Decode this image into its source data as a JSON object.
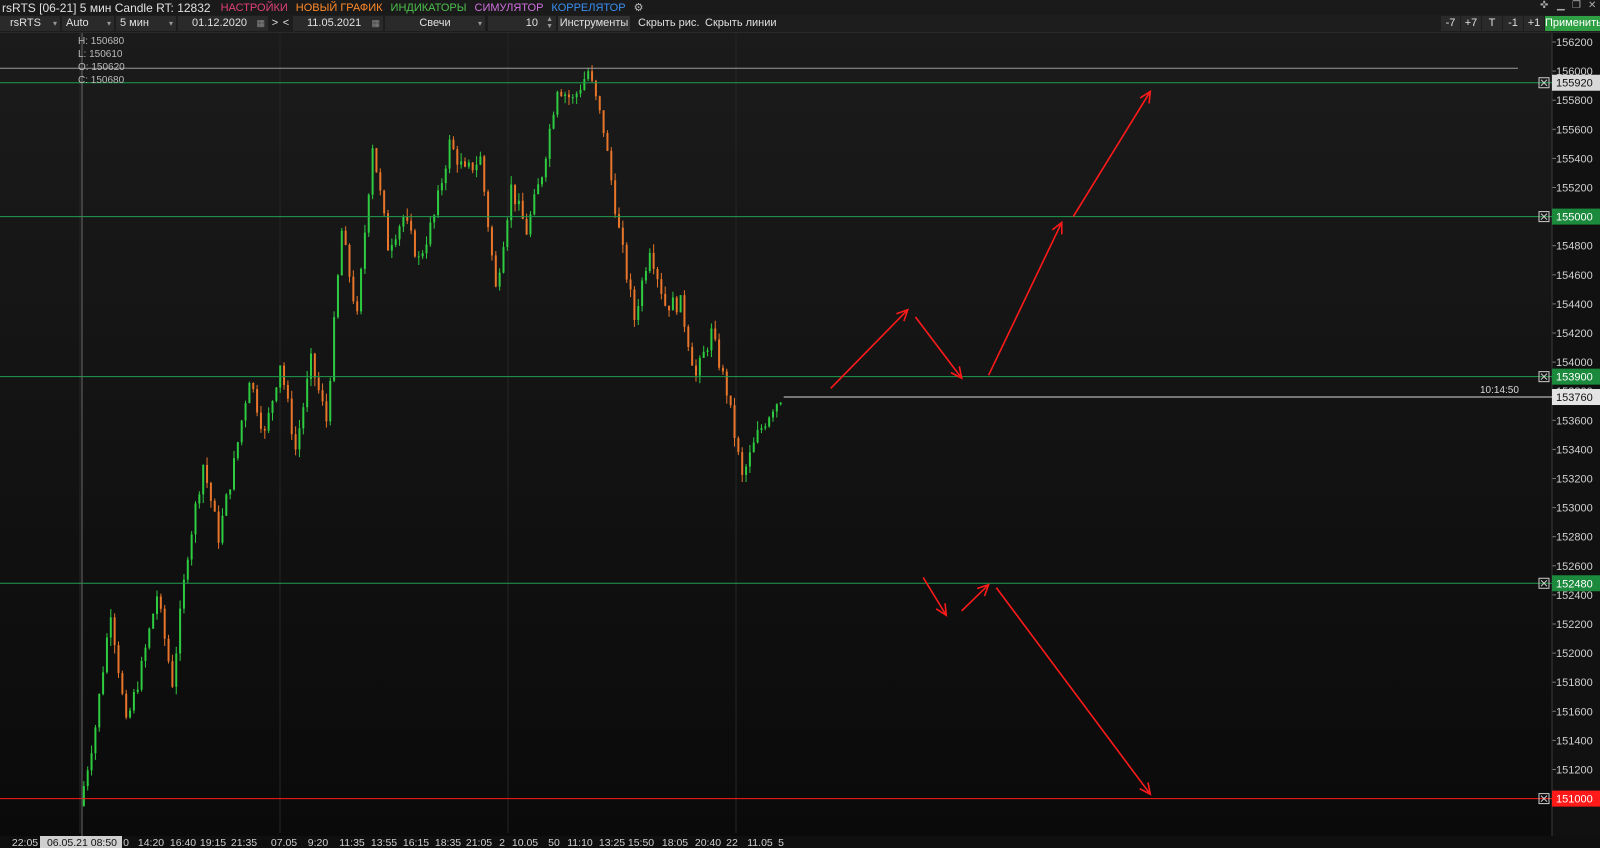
{
  "window": {
    "title": "rsRTS [06-21] 5 мин Candle RT: 12832",
    "menu": [
      {
        "label": "НАСТРОЙКИ",
        "color": "#e0407a"
      },
      {
        "label": "НОВЫЙ ГРАФИК",
        "color": "#ff8a2a"
      },
      {
        "label": "ИНДИКАТОРЫ",
        "color": "#4ec04e"
      },
      {
        "label": "СИМУЛЯТОР",
        "color": "#d070e0"
      },
      {
        "label": "КОРРЕЛЯТОР",
        "color": "#3a8ff0"
      }
    ],
    "settings_icon": "gears-icon",
    "controls": [
      "pin-icon",
      "minimize-icon",
      "restore-icon",
      "close-icon"
    ]
  },
  "toolbar": {
    "symbol": "rsRTS",
    "scale": "Auto",
    "timeframe": "5 мин",
    "date_from": "01.12.2020",
    "nav_next": ">",
    "nav_prev": "<",
    "date_to": "11.05.2021",
    "chart_type": "Свечи",
    "count": "10",
    "instruments": "Инструменты",
    "hide_drawings": "Скрыть рис.",
    "hide_lines": "Скрыть линии",
    "zoom_buttons": [
      "-7",
      "+7",
      "T",
      "-1",
      "+1"
    ],
    "apply": "Применить"
  },
  "ohlc": {
    "h": "H: 150680",
    "l": "L: 150610",
    "o": "O: 150620",
    "c": "C: 150680"
  },
  "cursor_time": "06.05.21 08:50",
  "last_price": "153760",
  "last_time": "10:14:50",
  "colors": {
    "up": "#2ecc40",
    "down": "#e8752a",
    "hline": "#1f9e4f",
    "red": "#ff1a1a",
    "badge": "#1b8a3c"
  },
  "chart_data": {
    "type": "candlestick",
    "ylim": [
      150900,
      156300
    ],
    "y_ticks": [
      "156200",
      "156000",
      "155800",
      "155600",
      "155400",
      "155200",
      "155000",
      "154800",
      "154600",
      "154400",
      "154200",
      "154000",
      "153800",
      "153600",
      "153400",
      "153200",
      "153000",
      "152800",
      "152600",
      "152400",
      "152200",
      "152000",
      "151800",
      "151600",
      "151400",
      "151200",
      "151000"
    ],
    "x_labels": [
      "22:05",
      "06.05.21 08:50",
      "0",
      "14:20",
      "16:40",
      "19:15",
      "21:35",
      "07.05",
      "9:20",
      "11:35",
      "13:55",
      "16:15",
      "18:35",
      "21:05",
      "2",
      "10.05",
      "50",
      "11:10",
      "13:25",
      "15:50",
      "18:05",
      "20:40",
      "22",
      "11.05",
      "5"
    ],
    "price_path": [
      [
        0,
        150950
      ],
      [
        4,
        151500
      ],
      [
        8,
        152300
      ],
      [
        12,
        151500
      ],
      [
        16,
        151900
      ],
      [
        20,
        152400
      ],
      [
        24,
        151800
      ],
      [
        28,
        152700
      ],
      [
        32,
        153300
      ],
      [
        36,
        152800
      ],
      [
        40,
        153300
      ],
      [
        44,
        153900
      ],
      [
        48,
        153500
      ],
      [
        52,
        154000
      ],
      [
        56,
        153400
      ],
      [
        60,
        154000
      ],
      [
        64,
        153600
      ],
      [
        68,
        154900
      ],
      [
        72,
        154300
      ],
      [
        76,
        155500
      ],
      [
        80,
        154800
      ],
      [
        84,
        155000
      ],
      [
        88,
        154700
      ],
      [
        92,
        155000
      ],
      [
        96,
        155500
      ],
      [
        100,
        155300
      ],
      [
        104,
        155400
      ],
      [
        108,
        154500
      ],
      [
        112,
        155200
      ],
      [
        116,
        154900
      ],
      [
        120,
        155300
      ],
      [
        124,
        155900
      ],
      [
        128,
        155800
      ],
      [
        132,
        156000
      ],
      [
        136,
        155600
      ],
      [
        140,
        154900
      ],
      [
        144,
        154300
      ],
      [
        148,
        154800
      ],
      [
        152,
        154400
      ],
      [
        156,
        154400
      ],
      [
        160,
        153900
      ],
      [
        164,
        154200
      ],
      [
        168,
        153800
      ],
      [
        172,
        153200
      ],
      [
        176,
        153500
      ],
      [
        180,
        153700
      ],
      [
        182,
        153760
      ]
    ],
    "h_levels": [
      {
        "price": "155920",
        "color": "#1f9e4f",
        "badge": "light"
      },
      {
        "price": "155000",
        "color": "#1f9e4f",
        "badge": "green"
      },
      {
        "price": "153900",
        "color": "#1f9e4f",
        "badge": "green"
      },
      {
        "price": "152480",
        "color": "#1f9e4f",
        "badge": "green"
      },
      {
        "price": "151000",
        "color": "#ff1a1a",
        "badge": "red"
      }
    ],
    "ray_price": "156020",
    "arrows": [
      {
        "from": [
          195,
          153820
        ],
        "to": [
          215,
          154360
        ]
      },
      {
        "from": [
          217,
          154310
        ],
        "to": [
          229,
          153890
        ]
      },
      {
        "from": [
          236,
          153910
        ],
        "to": [
          255,
          154960
        ]
      },
      {
        "from": [
          258,
          155000
        ],
        "to": [
          278,
          155860
        ]
      },
      {
        "from": [
          219,
          152520
        ],
        "to": [
          225,
          152260
        ]
      },
      {
        "from": [
          229,
          152290
        ],
        "to": [
          236,
          152470
        ]
      },
      {
        "from": [
          238,
          152450
        ],
        "to": [
          278,
          151030
        ]
      }
    ]
  }
}
